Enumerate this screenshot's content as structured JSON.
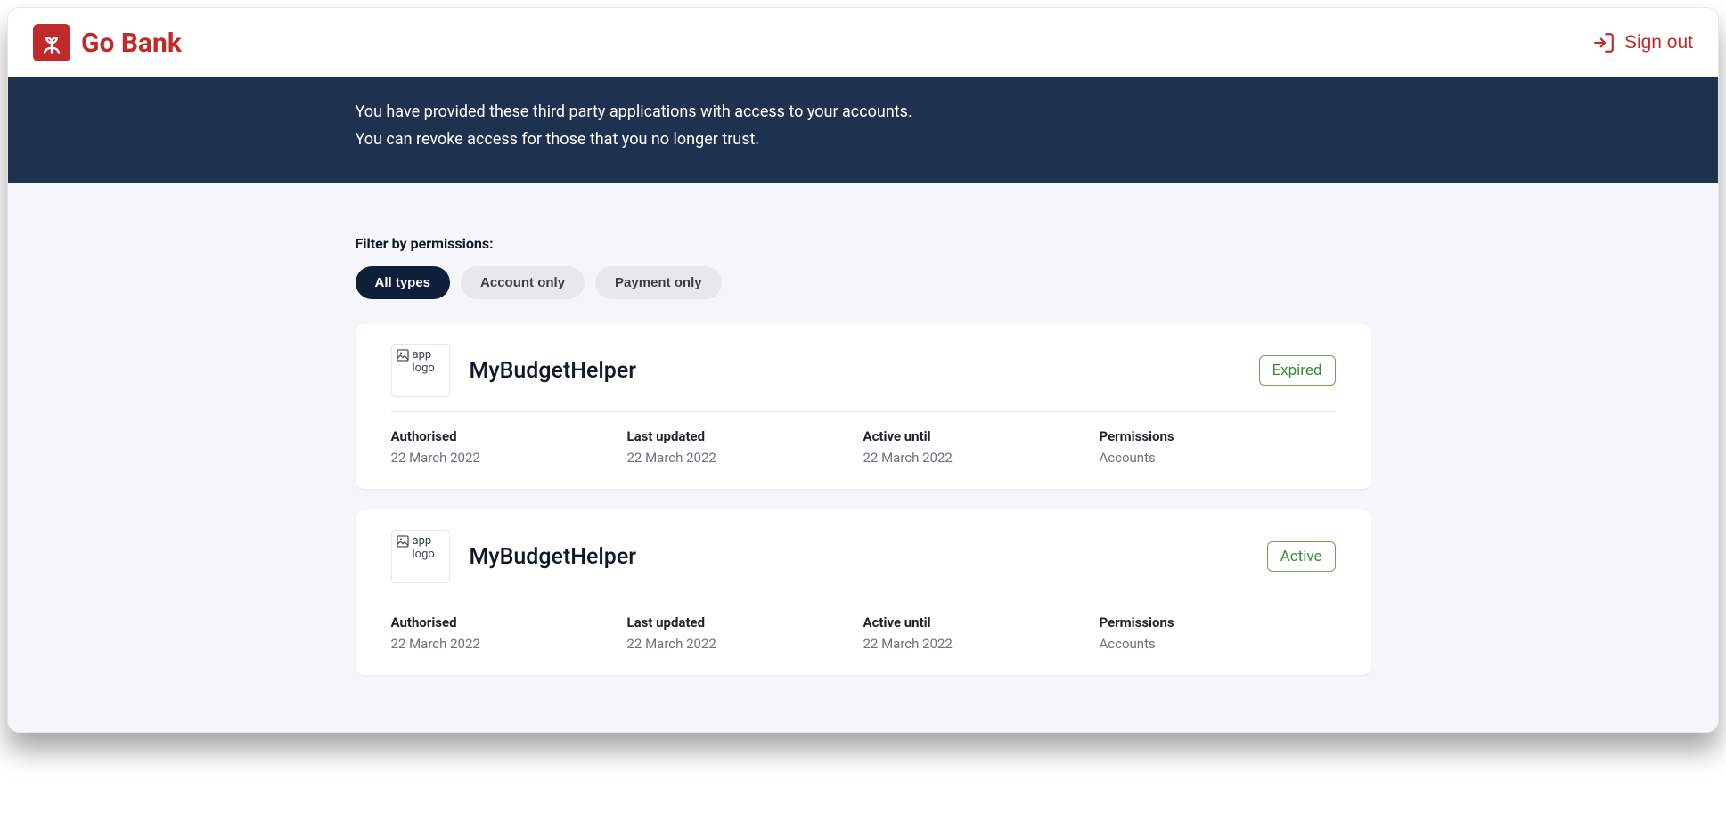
{
  "header": {
    "brand_name": "Go Bank",
    "signout_label": "Sign out"
  },
  "banner": {
    "line1": "You have provided these third party applications with access to your accounts.",
    "line2": "You can revoke access for those that you no longer trust."
  },
  "filter": {
    "label": "Filter by permissions:",
    "chips": [
      {
        "label": "All types",
        "active": true
      },
      {
        "label": "Account only",
        "active": false
      },
      {
        "label": "Payment only",
        "active": false
      }
    ]
  },
  "apps": [
    {
      "logo_alt": "app logo",
      "name": "MyBudgetHelper",
      "status": "Expired",
      "fields": {
        "authorised_label": "Authorised",
        "authorised_value": "22 March 2022",
        "last_updated_label": "Last updated",
        "last_updated_value": "22 March 2022",
        "active_until_label": "Active until",
        "active_until_value": "22 March 2022",
        "permissions_label": "Permissions",
        "permissions_value": "Accounts"
      }
    },
    {
      "logo_alt": "app logo",
      "name": "MyBudgetHelper",
      "status": "Active",
      "fields": {
        "authorised_label": "Authorised",
        "authorised_value": "22 March 2022",
        "last_updated_label": "Last updated",
        "last_updated_value": "22 March 2022",
        "active_until_label": "Active until",
        "active_until_value": "22 March 2022",
        "permissions_label": "Permissions",
        "permissions_value": "Accounts"
      }
    }
  ]
}
